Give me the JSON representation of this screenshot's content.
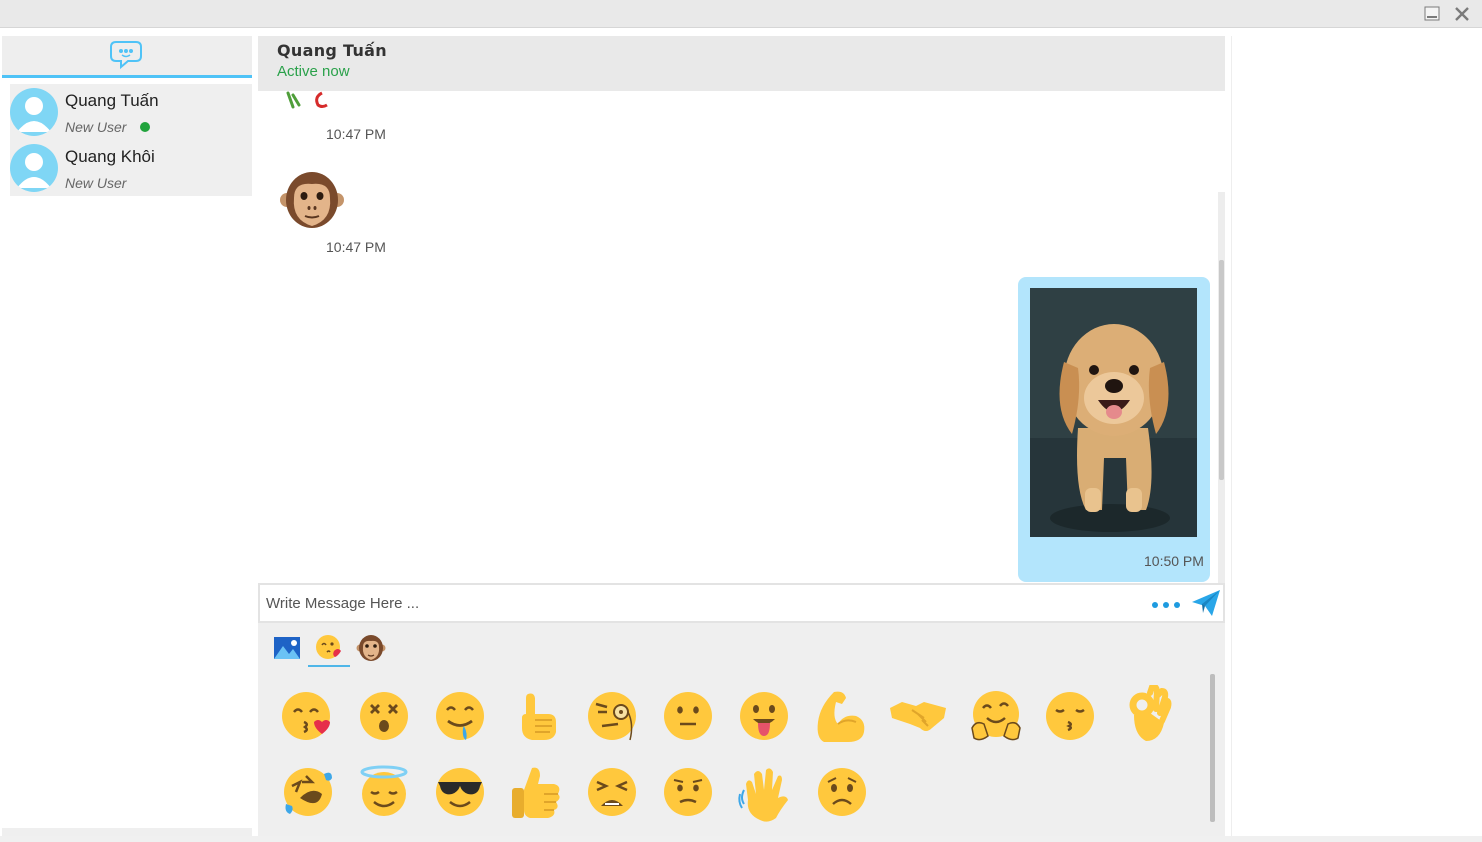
{
  "window": {
    "minimize_label": "minimize",
    "close_label": "close"
  },
  "sidebar": {
    "logo_icon": "chat-bubble-icon",
    "contacts": [
      {
        "name": "Quang Tuấn",
        "subtitle": "New User",
        "online": true
      },
      {
        "name": "Quang Khôi",
        "subtitle": "New User",
        "online": false
      }
    ]
  },
  "chat": {
    "header": {
      "name": "Quang Tuấn",
      "status": "Active now"
    },
    "messages": [
      {
        "type": "sticker",
        "direction": "in",
        "sticker": "partial-sticker",
        "time": "10:47 PM"
      },
      {
        "type": "sticker",
        "direction": "in",
        "sticker": "monkey-face",
        "time": "10:47 PM"
      },
      {
        "type": "image",
        "direction": "out",
        "image": "golden-retriever-puppy-photo",
        "time": "10:50 PM"
      }
    ],
    "input": {
      "placeholder": "Write Message Here ...",
      "value": ""
    }
  },
  "emoji_panel": {
    "tabs": [
      {
        "icon": "image-icon",
        "active": false
      },
      {
        "icon": "emoji-face-icon",
        "active": true
      },
      {
        "icon": "monkey-icon",
        "active": false
      }
    ],
    "emojis": [
      "face-blowing-kiss",
      "dizzy-face",
      "drooling-face",
      "call-me-hand",
      "face-with-monocle",
      "neutral-face",
      "face-with-tongue",
      "flexed-biceps",
      "handshake",
      "hugging-face",
      "kissing-face",
      "ok-hand",
      "rolling-on-floor-laughing",
      "smiling-face-with-halo",
      "smiling-face-with-sunglasses",
      "thumbs-up",
      "tired-face",
      "confused-face",
      "waving-hand",
      "worried-face"
    ]
  },
  "colors": {
    "accent": "#4fc3f7",
    "bubble_out": "#b3e5fc",
    "online": "#21a33c",
    "send": "#1e9be0"
  }
}
